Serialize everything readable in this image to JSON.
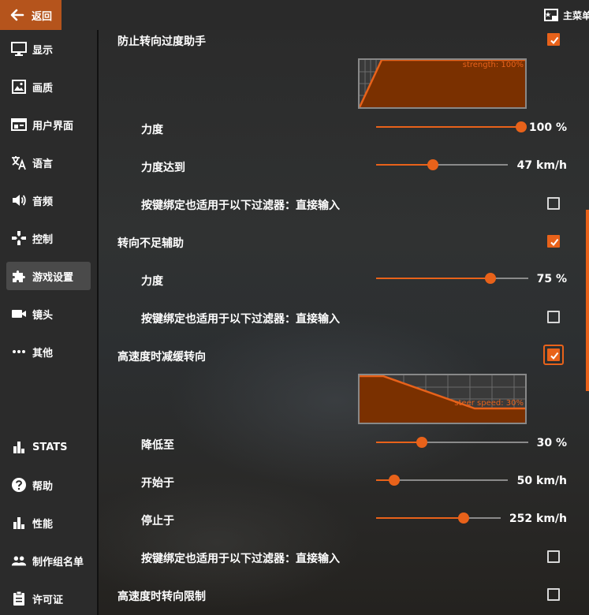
{
  "topbar": {
    "back_label": "返回",
    "main_menu_label": "主菜单"
  },
  "sidebar": {
    "items": [
      {
        "label": "显示",
        "icon": "monitor-icon"
      },
      {
        "label": "画质",
        "icon": "image-icon"
      },
      {
        "label": "用户界面",
        "icon": "window-icon"
      },
      {
        "label": "语言",
        "icon": "translate-icon"
      },
      {
        "label": "音频",
        "icon": "speaker-icon"
      },
      {
        "label": "控制",
        "icon": "gamepad-icon"
      },
      {
        "label": "游戏设置",
        "icon": "puzzle-icon",
        "active": true
      },
      {
        "label": "镜头",
        "icon": "camera-icon"
      },
      {
        "label": "其他",
        "icon": "more-icon"
      },
      {
        "label": "STATS",
        "icon": "bar-chart-icon"
      },
      {
        "label": "帮助",
        "icon": "help-icon"
      },
      {
        "label": "性能",
        "icon": "performance-icon"
      },
      {
        "label": "制作组名单",
        "icon": "people-icon"
      },
      {
        "label": "许可证",
        "icon": "clipboard-icon"
      }
    ]
  },
  "settings": {
    "oversteer": {
      "label": "防止转向过度助手",
      "checked": true,
      "graph_caption": "strength: 100%",
      "strength_label": "力度",
      "strength_value": "100 %",
      "strength_fraction": 1.0,
      "reach_label": "力度达到",
      "reach_value": "47 km/h",
      "reach_fraction": 0.43,
      "binding_label": "按键绑定也适用于以下过滤器：直接输入",
      "binding_checked": false
    },
    "understeer": {
      "label": "转向不足辅助",
      "checked": true,
      "strength_label": "力度",
      "strength_value": "75 %",
      "strength_fraction": 0.75,
      "binding_label": "按键绑定也适用于以下过滤器：直接输入",
      "binding_checked": false
    },
    "slow_steer": {
      "label": "高速度时减缓转向",
      "checked": true,
      "graph_caption": "steer speed: 30%",
      "reduce_label": "降低至",
      "reduce_value": "30 %",
      "reduce_fraction": 0.3,
      "start_label": "开始于",
      "start_value": "50 km/h",
      "start_fraction": 0.14,
      "stop_label": "停止于",
      "stop_value": "252 km/h",
      "stop_fraction": 0.7,
      "binding_label": "按键绑定也适用于以下过滤器：直接输入",
      "binding_checked": false
    },
    "steer_limit": {
      "label": "高速度时转向限制",
      "checked": false
    }
  },
  "colors": {
    "accent": "#e8621a",
    "back_button": "#b5541c",
    "graph_fill": "#7a3000"
  }
}
